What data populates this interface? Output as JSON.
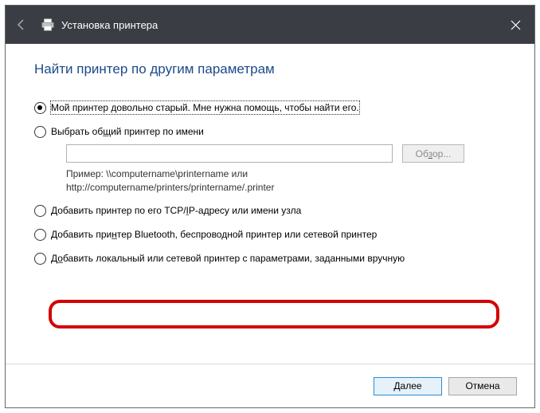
{
  "header": {
    "title": "Установка принтера"
  },
  "heading": "Найти принтер по другим параметрам",
  "options": [
    {
      "label": "Мой принтер довольно старый. Мне нужна помощь, чтобы найти его.",
      "checked": true
    },
    {
      "pre": "Выбрать об",
      "ul": "щ",
      "post": "ий принтер по имени"
    },
    {
      "pre": "Добавить принтер по его TCP/",
      "ul": "I",
      "post": "P-адресу или имени узла"
    },
    {
      "pre": "Добавить при",
      "ul": "н",
      "post": "тер Bluetooth, беспроводной принтер или сетевой принтер"
    },
    {
      "pre": "Д",
      "ul": "о",
      "post": "бавить локальный или сетевой принтер с параметрами, заданными вручную"
    }
  ],
  "shared": {
    "value": "",
    "browse_pre": "Об",
    "browse_ul": "з",
    "browse_post": "ор...",
    "example_line1": "Пример: \\\\computername\\printername или",
    "example_line2": "http://computername/printers/printername/.printer"
  },
  "footer": {
    "next_ul": "Д",
    "next_post": "алее",
    "cancel": "Отмена"
  }
}
